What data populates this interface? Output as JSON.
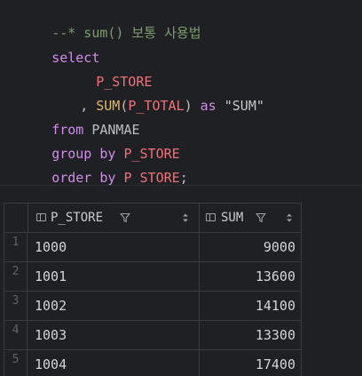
{
  "editor": {
    "comment": "--* sum() 보통 사용법",
    "kw_select": "select",
    "col_store_1": "P_STORE",
    "comma": ",",
    "fn_sum": "SUM",
    "paren_open": "(",
    "col_total": "P_TOTAL",
    "paren_close": ")",
    "kw_as": "as",
    "alias_sum": "\"SUM\"",
    "kw_from": "from",
    "table_name": "PANMAE",
    "kw_group_by": "group by",
    "col_store_2": "P_STORE",
    "kw_order_by": "order by",
    "col_store_3": "P_STORE",
    "semicolon": ";"
  },
  "results": {
    "columns": [
      {
        "label": "P_STORE"
      },
      {
        "label": "SUM"
      }
    ],
    "rows": [
      {
        "num": "1",
        "p_store": "1000",
        "sum": "9000"
      },
      {
        "num": "2",
        "p_store": "1001",
        "sum": "13600"
      },
      {
        "num": "3",
        "p_store": "1002",
        "sum": "14100"
      },
      {
        "num": "4",
        "p_store": "1003",
        "sum": "13300"
      },
      {
        "num": "5",
        "p_store": "1004",
        "sum": "17400"
      }
    ]
  },
  "icons": {
    "column": "column-icon",
    "filter": "filter-icon",
    "sort": "sort-icon"
  },
  "colors": {
    "background": "#1f2023",
    "keyword": "#cf8ee8",
    "column": "#f07178",
    "function": "#e5b566",
    "comment": "#7a9e6c"
  }
}
